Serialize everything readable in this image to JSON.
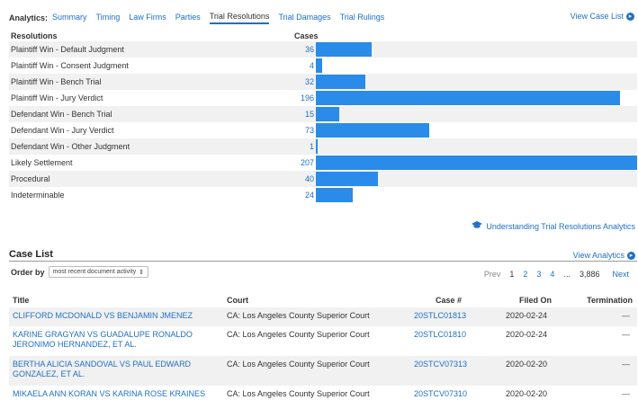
{
  "nav": {
    "label": "Analytics:",
    "tabs": [
      "Summary",
      "Timing",
      "Law Firms",
      "Parties",
      "Trial Resolutions",
      "Trial Damages",
      "Trial Rulings"
    ],
    "active_tab": "Trial Resolutions",
    "view_case_list": "View Case List"
  },
  "resolutions": {
    "header_resolution": "Resolutions",
    "header_cases": "Cases",
    "max_value": 207,
    "rows": [
      {
        "label": "Plaintiff Win - Default Judgment",
        "count": "36",
        "value": 36
      },
      {
        "label": "Plaintiff Win - Consent Judgment",
        "count": "4",
        "value": 4
      },
      {
        "label": "Plaintiff Win - Bench Trial",
        "count": "32",
        "value": 32
      },
      {
        "label": "Plaintiff Win - Jury Verdict",
        "count": "196",
        "value": 196
      },
      {
        "label": "Defendant Win - Bench Trial",
        "count": "15",
        "value": 15
      },
      {
        "label": "Defendant Win - Jury Verdict",
        "count": "73",
        "value": 73
      },
      {
        "label": "Defendant Win - Other Judgment",
        "count": "1",
        "value": 1
      },
      {
        "label": "Likely Settlement",
        "count": "207",
        "value": 207
      },
      {
        "label": "Procedural",
        "count": "40",
        "value": 40
      },
      {
        "label": "Indeterminable",
        "count": "24",
        "value": 24
      }
    ],
    "bar_color": "#2a8be8",
    "understanding_link": "Understanding Trial Resolutions Analytics"
  },
  "case_list": {
    "title": "Case List",
    "view_analytics": "View Analytics",
    "order_by_label": "Order by",
    "order_by_value": "most recent document activity",
    "pagination": {
      "prev": "Prev",
      "pages": [
        "1",
        "2",
        "3",
        "4"
      ],
      "current": "1",
      "ellipsis": "...",
      "total": "3,886",
      "next": "Next"
    },
    "columns": {
      "title": "Title",
      "court": "Court",
      "case_no": "Case #",
      "filed_on": "Filed On",
      "termination": "Termination"
    },
    "rows": [
      {
        "title": "CLIFFORD MCDONALD VS BENJAMIN JMENEZ",
        "court": "CA: Los Angeles County Superior Court",
        "case_no": "20STLC01813",
        "filed_on": "2020-02-24",
        "termination": "—"
      },
      {
        "title": "KARINE GRAGYAN VS GUADALUPE RONALDO JERONIMO HERNANDEZ, ET AL.",
        "court": "CA: Los Angeles County Superior Court",
        "case_no": "20STLC01810",
        "filed_on": "2020-02-24",
        "termination": "—"
      },
      {
        "title": "BERTHA ALICIA SANDOVAL VS PAUL EDWARD GONZALEZ, ET AL.",
        "court": "CA: Los Angeles County Superior Court",
        "case_no": "20STCV07313",
        "filed_on": "2020-02-20",
        "termination": "—"
      },
      {
        "title": "MIKAELA ANN KORAN VS KARINA ROSE KRAINES",
        "court": "CA: Los Angeles County Superior Court",
        "case_no": "20STCV07310",
        "filed_on": "2020-02-20",
        "termination": "—"
      }
    ]
  },
  "colors": {
    "link": "#1f6fc5",
    "row_alt": "#f1f1f1"
  }
}
